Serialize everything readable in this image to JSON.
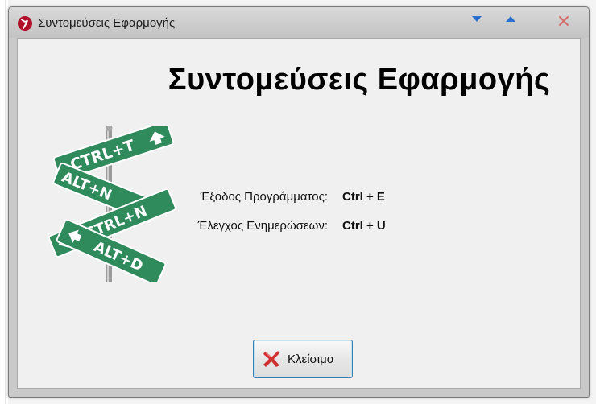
{
  "window": {
    "title": "Συντομεύσεις Εφαρμογής"
  },
  "heading": "Συντομεύσεις Εφαρμογής",
  "illustration": {
    "signs": [
      "CTRL+T",
      "ALT+N",
      "CTRL+N",
      "ALT+D"
    ],
    "sign_color": "#2f8a5c"
  },
  "shortcuts": [
    {
      "label": "Έξοδος Προγράμματος:",
      "keys": "Ctrl + E"
    },
    {
      "label": "Έλεγχος Ενημερώσεων:",
      "keys": "Ctrl + U"
    }
  ],
  "close_button": {
    "label": "Κλείσιμο",
    "icon": "red-x-icon"
  },
  "titlebar_icons": {
    "app": "app-logo-icon",
    "minimize": "triangle-down-icon",
    "maximize": "triangle-up-icon",
    "close": "close-x-icon"
  },
  "colors": {
    "accent_blue": "#2a6fd0",
    "close_red": "#d03030"
  }
}
